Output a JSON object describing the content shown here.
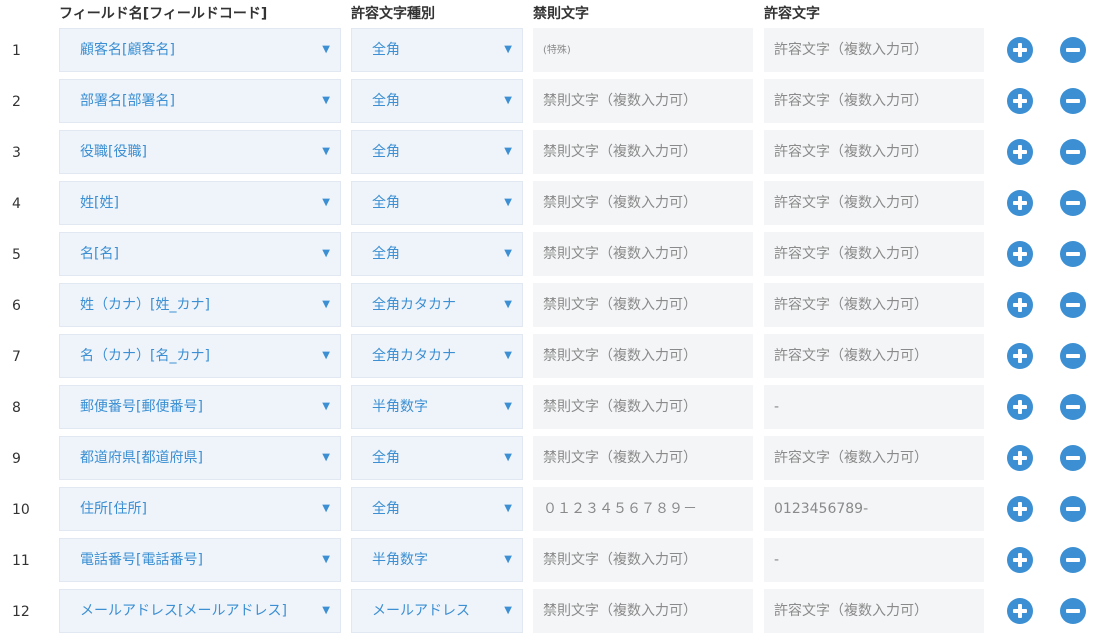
{
  "headers": {
    "field": "フィールド名[フィールドコード]",
    "char_type": "許容文字種別",
    "forbidden": "禁則文字",
    "allowed": "許容文字"
  },
  "icons": {
    "add": "plus-circle-icon",
    "remove": "minus-circle-icon",
    "dropdown": "dropdown-arrow-icon",
    "arrow_glyph": "▼"
  },
  "colors": {
    "accent": "#3b8fd2",
    "select_bg": "#eff4fb",
    "input_bg": "#f4f5f7"
  },
  "rows": [
    {
      "num": "1",
      "field": "顧客名[顧客名]",
      "type": "全角",
      "forbidden": "",
      "forbidden_placeholder": "(特殊)",
      "allowed": "",
      "allowed_placeholder": "許容文字（複数入力可）"
    },
    {
      "num": "2",
      "field": "部署名[部署名]",
      "type": "全角",
      "forbidden": "",
      "forbidden_placeholder": "禁則文字（複数入力可）",
      "allowed": "",
      "allowed_placeholder": "許容文字（複数入力可）"
    },
    {
      "num": "3",
      "field": "役職[役職]",
      "type": "全角",
      "forbidden": "",
      "forbidden_placeholder": "禁則文字（複数入力可）",
      "allowed": "",
      "allowed_placeholder": "許容文字（複数入力可）"
    },
    {
      "num": "4",
      "field": "姓[姓]",
      "type": "全角",
      "forbidden": "",
      "forbidden_placeholder": "禁則文字（複数入力可）",
      "allowed": "",
      "allowed_placeholder": "許容文字（複数入力可）"
    },
    {
      "num": "5",
      "field": "名[名]",
      "type": "全角",
      "forbidden": "",
      "forbidden_placeholder": "禁則文字（複数入力可）",
      "allowed": "",
      "allowed_placeholder": "許容文字（複数入力可）"
    },
    {
      "num": "6",
      "field": "姓（カナ）[姓_カナ]",
      "type": "全角カタカナ",
      "forbidden": "",
      "forbidden_placeholder": "禁則文字（複数入力可）",
      "allowed": "",
      "allowed_placeholder": "許容文字（複数入力可）"
    },
    {
      "num": "7",
      "field": "名（カナ）[名_カナ]",
      "type": "全角カタカナ",
      "forbidden": "",
      "forbidden_placeholder": "禁則文字（複数入力可）",
      "allowed": "",
      "allowed_placeholder": "許容文字（複数入力可）"
    },
    {
      "num": "8",
      "field": "郵便番号[郵便番号]",
      "type": "半角数字",
      "forbidden": "",
      "forbidden_placeholder": "禁則文字（複数入力可）",
      "allowed": "",
      "allowed_placeholder": "-"
    },
    {
      "num": "9",
      "field": "都道府県[都道府県]",
      "type": "全角",
      "forbidden": "",
      "forbidden_placeholder": "禁則文字（複数入力可）",
      "allowed": "",
      "allowed_placeholder": "許容文字（複数入力可）"
    },
    {
      "num": "10",
      "field": "住所[住所]",
      "type": "全角",
      "forbidden": "",
      "forbidden_placeholder": "０１２３４５６７８９－",
      "allowed": "",
      "allowed_placeholder": "0123456789-"
    },
    {
      "num": "11",
      "field": "電話番号[電話番号]",
      "type": "半角数字",
      "forbidden": "",
      "forbidden_placeholder": "禁則文字（複数入力可）",
      "allowed": "",
      "allowed_placeholder": "-"
    },
    {
      "num": "12",
      "field": "メールアドレス[メールアドレス]",
      "type": "メールアドレス",
      "forbidden": "",
      "forbidden_placeholder": "禁則文字（複数入力可）",
      "allowed": "",
      "allowed_placeholder": "許容文字（複数入力可）"
    }
  ]
}
